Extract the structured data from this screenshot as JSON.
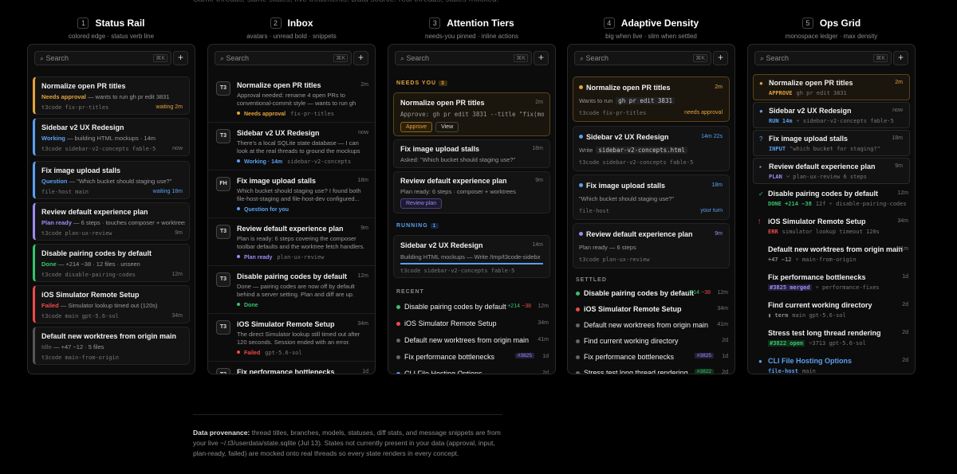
{
  "top_text": "Same threads, same states, five treatments. Data source: real threads, states mocked.",
  "columns": [
    {
      "num": "1",
      "title": "Status Rail",
      "subtitle": "colored edge · status verb line"
    },
    {
      "num": "2",
      "title": "Inbox",
      "subtitle": "avatars · unread bold · snippets"
    },
    {
      "num": "3",
      "title": "Attention Tiers",
      "subtitle": "needs-you pinned · inline actions"
    },
    {
      "num": "4",
      "title": "Adaptive Density",
      "subtitle": "big when live · slim when settled"
    },
    {
      "num": "5",
      "title": "Ops Grid",
      "subtitle": "monospace ledger · max density"
    }
  ],
  "search": {
    "placeholder": "Search",
    "kbd": "⌘K",
    "plus": "+"
  },
  "rail": [
    {
      "title": "Normalize open PR titles",
      "verb": "Needs approval",
      "desc": "— wants to run gh pr edit 3831",
      "meta": "t3code  fix-pr-titles",
      "right": "waiting 2m"
    },
    {
      "title": "Sidebar v2 UX Redesign",
      "verb": "Working",
      "desc": "— building HTML mockups · 14m",
      "meta": "t3code  sidebar-v2-concepts  fable-5",
      "right": "now"
    },
    {
      "title": "Fix image upload stalls",
      "verb": "Question",
      "desc": "— \"Which bucket should staging use?\"",
      "meta": "file-host  main",
      "right": "waiting 18m"
    },
    {
      "title": "Review default experience plan",
      "verb": "Plan ready",
      "desc": "— 6 steps · touches composer + worktrees",
      "meta": "t3code  plan-ux-review",
      "right": "9m"
    },
    {
      "title": "Disable pairing codes by default",
      "verb": "Done",
      "desc": "— +214 −38 · 12 files · unseen",
      "meta": "t3code  disable-pairing-codes",
      "right": "12m"
    },
    {
      "title": "iOS Simulator Remote Setup",
      "verb": "Failed",
      "desc": "— Simulator lookup timed out (120s)",
      "meta": "t3code  main  gpt-5.6-sol",
      "right": "34m"
    },
    {
      "title": "Default new worktrees from origin main",
      "verb": "Idle",
      "desc": "— +47 −12 · 5 files",
      "meta": "t3code  main-from-origin",
      "right": ""
    }
  ],
  "inbox": [
    {
      "av": "T3",
      "title": "Normalize open PR titles",
      "time": "2m",
      "snip": "Approval needed: rename 4 open PRs to conventional-commit style — wants to run gh pr...",
      "status": "Needs approval",
      "meta": "fix-pr-titles"
    },
    {
      "av": "T3",
      "title": "Sidebar v2 UX Redesign",
      "time": "now",
      "snip": "There's a local SQLite state database — I can look at the real threads to ground the mockups in...",
      "status": "Working · 14m",
      "meta": "sidebar-v2-concepts"
    },
    {
      "av": "FH",
      "title": "Fix image upload stalls",
      "time": "18m",
      "snip": "Which bucket should staging use? I found both file-host-staging and file-host-dev configured...",
      "status": "Question for you",
      "meta": ""
    },
    {
      "av": "T3",
      "title": "Review default experience plan",
      "time": "9m",
      "snip": "Plan is ready: 6 steps covering the composer toolbar defaults and the worktree fetch handlers.",
      "status": "Plan ready",
      "meta": "plan-ux-review"
    },
    {
      "av": "T3",
      "title": "Disable pairing codes by default",
      "time": "12m",
      "snip": "Done — pairing codes are now off by default behind a server setting. Plan and diff are up.",
      "status": "Done",
      "meta": ""
    },
    {
      "av": "T3",
      "title": "iOS Simulator Remote Setup",
      "time": "34m",
      "snip": "The direct Simulator lookup still timed out after 120 seconds. Session ended with an error.",
      "status": "Failed",
      "meta": "gpt-5.6-sol"
    },
    {
      "av": "T3",
      "title": "Fix performance bottlenecks",
      "time": "1d",
      "snip": "",
      "status": "",
      "meta": ""
    }
  ],
  "tiers": {
    "needs_label": "NEEDS YOU",
    "needs_count": "3",
    "running_label": "RUNNING",
    "running_count": "1",
    "recent_label": "RECENT",
    "needs": [
      {
        "title": "Normalize open PR titles",
        "time": "2m",
        "line": "Approve: gh pr edit 3831 --title \"fix(mobile): …\"",
        "btn1": "Approve",
        "btn2": "View"
      },
      {
        "title": "Fix image upload stalls",
        "time": "18m",
        "line": "Asked: \"Which bucket should staging use?\""
      },
      {
        "title": "Review default experience plan",
        "time": "9m",
        "line": "Plan ready: 6 steps · composer + worktrees",
        "btn1": "Review plan"
      }
    ],
    "running": {
      "title": "Sidebar v2 UX Redesign",
      "time": "14m",
      "line": "Building HTML mockups — Write /tmp/t3code-sidebar...",
      "meta": "t3code  sidebar-v2-concepts  fable-5"
    },
    "recent": [
      {
        "title": "Disable pairing codes by default",
        "add": "+214",
        "del": "−38",
        "time": "12m"
      },
      {
        "title": "iOS Simulator Remote Setup",
        "time": "34m"
      },
      {
        "title": "Default new worktrees from origin main",
        "time": "41m"
      },
      {
        "title": "Fix performance bottlenecks",
        "badge": "#3825",
        "time": "1d"
      },
      {
        "title": "CLI File Hosting Options",
        "time": "2d"
      }
    ]
  },
  "density": {
    "live": [
      {
        "title": "Normalize open PR titles",
        "time": "2m",
        "line1": "Wants to run",
        "code": "gh pr edit 3831",
        "meta": "t3code  fix-pr-titles",
        "right": "needs approval"
      },
      {
        "title": "Sidebar v2 UX Redesign",
        "time": "14m 22s",
        "line1": "Write",
        "code": "sidebar-v2-concepts.html",
        "meta": "t3code  sidebar-v2-concepts  fable-5",
        "right": ""
      },
      {
        "title": "Fix image upload stalls",
        "time": "18m",
        "line1": "\"Which bucket should staging use?\"",
        "code": "",
        "meta": "file-host",
        "right": "your turn"
      },
      {
        "title": "Review default experience plan",
        "time": "9m",
        "line1": "Plan ready — 6 steps",
        "code": "",
        "meta": "t3code  plan-ux-review",
        "right": ""
      }
    ],
    "settled_label": "SETTLED",
    "settled": [
      {
        "title": "Disable pairing codes by default",
        "add": "+214",
        "del": "−38",
        "time": "12m"
      },
      {
        "title": "iOS Simulator Remote Setup",
        "time": "34m"
      },
      {
        "title": "Default new worktrees from origin main",
        "time": "41m"
      },
      {
        "title": "Find current working directory",
        "time": "2d"
      },
      {
        "title": "Fix performance bottlenecks",
        "badge": "#3825",
        "time": "1d"
      },
      {
        "title": "Stress test long thread rendering",
        "badge": "#3822",
        "time": "2d"
      }
    ]
  },
  "ops": [
    {
      "icon": "●",
      "title": "Normalize open PR titles",
      "time": "2m",
      "code": "APPROVE",
      "rest": "gh pr edit 3831"
    },
    {
      "icon": "●",
      "title": "Sidebar v2 UX Redesign",
      "time": "now",
      "code": "RUN 14m",
      "rest": "⑂ sidebar-v2-concepts  fable-5"
    },
    {
      "icon": "?",
      "title": "Fix image upload stalls",
      "time": "18m",
      "code": "INPUT",
      "rest": "\"which bucket for staging?\""
    },
    {
      "icon": "▪",
      "title": "Review default experience plan",
      "time": "9m",
      "code": "PLAN",
      "rest": "⑂ plan-ux-review  6 steps"
    },
    {
      "icon": "✓",
      "title": "Disable pairing codes by default",
      "time": "12m",
      "code": "DONE +214 −38",
      "rest": "12f  ⑂ disable-pairing-codes"
    },
    {
      "icon": "!",
      "title": "iOS Simulator Remote Setup",
      "time": "34m",
      "code": "ERR",
      "rest": "simulator lookup timeout 120s"
    },
    {
      "icon": "",
      "title": "Default new worktrees from origin main",
      "time": "41m",
      "code": "+47 −12",
      "rest": "⑂ main-from-origin"
    },
    {
      "icon": "",
      "title": "Fix performance bottlenecks",
      "time": "1d",
      "code": "#3825 merged",
      "rest": "⑂ performance-fixes"
    },
    {
      "icon": "",
      "title": "Find current working directory",
      "time": "2d",
      "code": "▮ term",
      "rest": "main  gpt-5.6-sol"
    },
    {
      "icon": "",
      "title": "Stress test long thread rendering",
      "time": "2d",
      "code": "#3822 open",
      "rest": "⑂3713  gpt-5.6-sol"
    },
    {
      "icon": "●",
      "title": "CLI File Hosting Options",
      "time": "2d",
      "code": "file-host",
      "rest": "main"
    }
  ],
  "footer": {
    "label": "Data provenance:",
    "text": "thread titles, branches, models, statuses, diff stats, and message snippets are from your live ~/.t3/userdata/state.sqlite (Jul 13). States not currently present in your data (approval, input, plan-ready, failed) are mocked onto real threads so every state renders in every concept."
  },
  "colors": {
    "amber": "#e6a23c",
    "blue": "#5aa0f0",
    "green": "#35c46a",
    "red": "#ef4a4a",
    "purple": "#9a8cf2"
  }
}
